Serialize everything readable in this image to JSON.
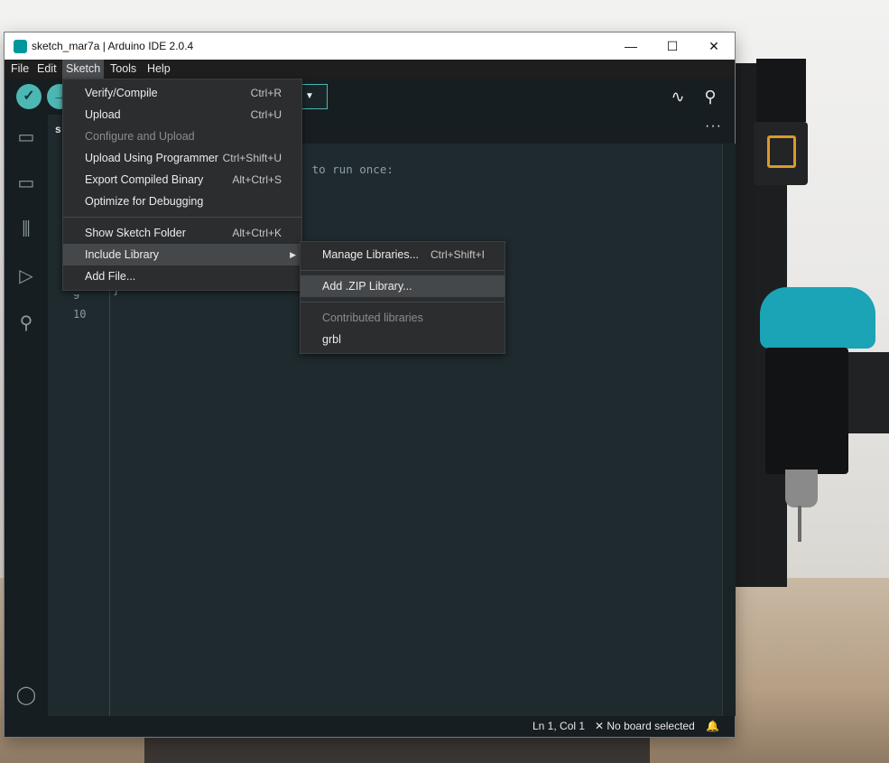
{
  "window": {
    "title": "sketch_mar7a | Arduino IDE 2.0.4",
    "app_icon": "∞",
    "controls": {
      "minimize": "—",
      "maximize": "☐",
      "close": "✕"
    }
  },
  "menubar": {
    "items": [
      {
        "label": "File"
      },
      {
        "label": "Edit"
      },
      {
        "label": "Sketch"
      },
      {
        "label": "Tools"
      },
      {
        "label": "Help"
      }
    ]
  },
  "tab": {
    "label": "s"
  },
  "editor": {
    "visible_code": "e, to run once:",
    "partial_brace": "}",
    "partial_line_number": "9",
    "line_10": "10"
  },
  "sketch_menu": {
    "items": [
      {
        "label": "Verify/Compile",
        "shortcut": "Ctrl+R",
        "enabled": true
      },
      {
        "label": "Upload",
        "shortcut": "Ctrl+U",
        "enabled": true
      },
      {
        "label": "Configure and Upload",
        "shortcut": "",
        "enabled": false
      },
      {
        "label": "Upload Using Programmer",
        "shortcut": "Ctrl+Shift+U",
        "enabled": true
      },
      {
        "label": "Export Compiled Binary",
        "shortcut": "Alt+Ctrl+S",
        "enabled": true
      },
      {
        "label": "Optimize for Debugging",
        "shortcut": "",
        "enabled": true
      },
      {
        "label": "Show Sketch Folder",
        "shortcut": "Alt+Ctrl+K",
        "enabled": true
      },
      {
        "label": "Include Library",
        "shortcut": "",
        "enabled": true,
        "submenu": true,
        "highlighted": true
      },
      {
        "label": "Add File...",
        "shortcut": "",
        "enabled": true
      }
    ]
  },
  "include_library_menu": {
    "items": [
      {
        "label": "Manage Libraries...",
        "shortcut": "Ctrl+Shift+I",
        "enabled": true
      },
      {
        "label": "Add .ZIP Library...",
        "shortcut": "",
        "enabled": true,
        "highlighted": true
      },
      {
        "label": "Contributed libraries",
        "shortcut": "",
        "enabled": false
      },
      {
        "label": "grbl",
        "shortcut": "",
        "enabled": true
      }
    ]
  },
  "statusbar": {
    "position": "Ln 1, Col 1",
    "board": "✕ No board selected"
  },
  "icons": {
    "verify": "✓",
    "upload": "→",
    "dropdown": "▼",
    "serial_plotter": "∿",
    "serial_monitor": "⚲",
    "more": "···",
    "folder": "▭",
    "boards": "▭",
    "library": "⫼",
    "debug": "▷",
    "search": "⚲",
    "account": "◯",
    "bell": "🔔",
    "submenu_arrow": "▶"
  }
}
